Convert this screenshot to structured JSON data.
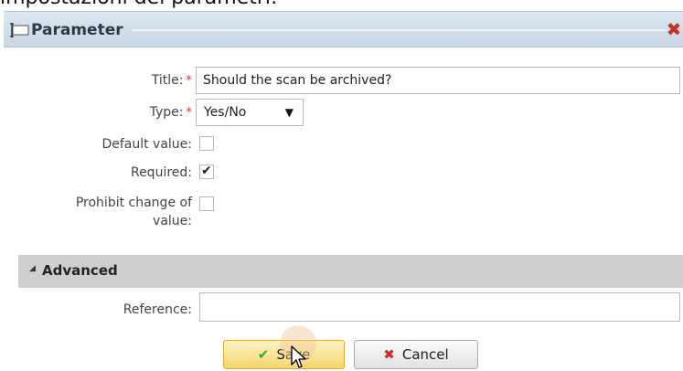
{
  "caption": "impostazioni dei parametri:",
  "dialog": {
    "title": "Parameter",
    "close_icon": "close-x-icon",
    "colors": {
      "close": "#c8312a",
      "save_bg": "#f5d66d",
      "section_bg": "#cfcfcf"
    }
  },
  "form": {
    "title_label": "Title:",
    "title_required": "*",
    "title_value": "Should the scan be archived?",
    "type_label": "Type:",
    "type_required": "*",
    "type_value": "Yes/No",
    "default_label": "Default value:",
    "default_checked": false,
    "required_label": "Required:",
    "required_checked": true,
    "prohibit_label_line1": "Prohibit change of",
    "prohibit_label_line2": "value:",
    "prohibit_checked": false
  },
  "advanced": {
    "header": "Advanced",
    "reference_label": "Reference:",
    "reference_value": ""
  },
  "buttons": {
    "save_label": "Save",
    "save_icon": "checkmark-icon",
    "cancel_label": "Cancel",
    "cancel_icon": "x-icon"
  }
}
